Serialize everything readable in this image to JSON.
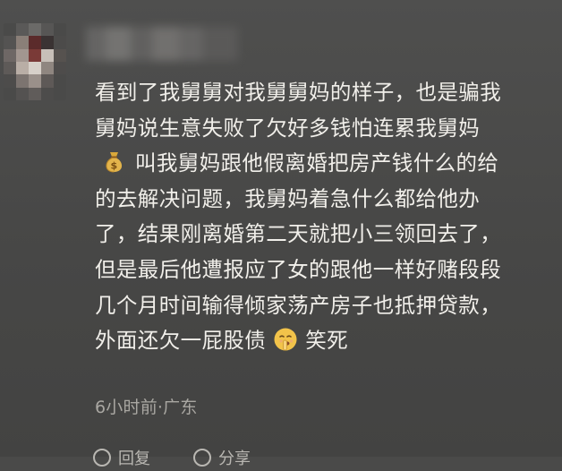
{
  "comment": {
    "lines": [
      {
        "text": "看到了我舅舅对我舅舅妈的样子，也是骗我"
      },
      {
        "text": "舅妈说生意失败了欠好多钱怕连累我舅妈"
      },
      {
        "prefix_icon": "money-bag-emoji",
        "text": "叫我舅妈跟他假离婚把房产钱什么的给"
      },
      {
        "text": "的去解决问题，我舅妈着急什么都给他办"
      },
      {
        "text": "了，结果刚离婚第二天就把小三领回去了，"
      },
      {
        "text": "但是最后他遭报应了女的跟他一样好赌段段"
      },
      {
        "text": "几个月时间输得倾家荡产房子也抵押贷款，"
      },
      {
        "text": "外面还欠一屁股债",
        "inline_icon": "shushing-face-emoji",
        "suffix": "笑死"
      }
    ]
  },
  "meta": {
    "time_location": "6小时前·广东"
  },
  "actions": {
    "reply_label": "回复",
    "share_label": "分享"
  },
  "colors": {
    "background": "#4a4a49",
    "text": "#f1efea",
    "meta_text": "#a9a7a2"
  }
}
